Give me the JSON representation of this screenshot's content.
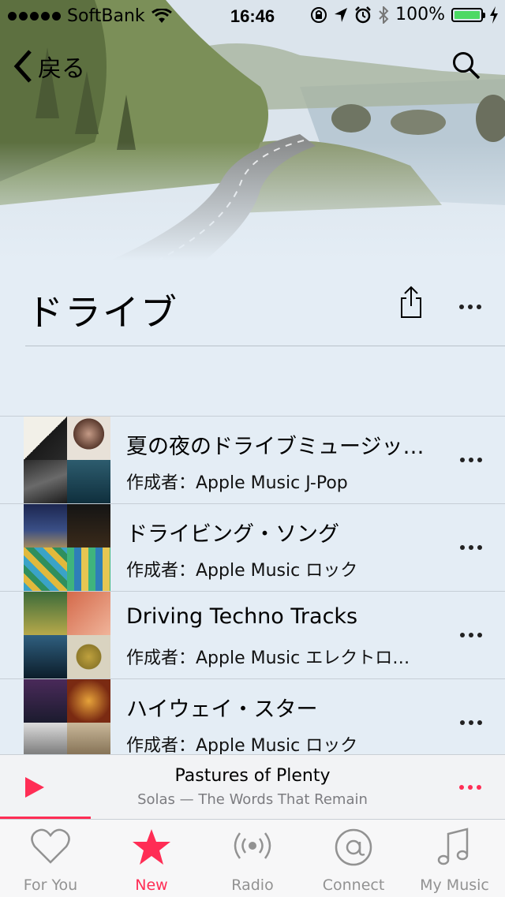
{
  "status_bar": {
    "carrier": "SoftBank",
    "time": "16:46",
    "battery": "100%",
    "battery_level": 1.0,
    "battery_color": "#4cd964"
  },
  "nav": {
    "back_label": "戻る",
    "search_icon": "search-icon"
  },
  "header": {
    "title": "ドライブ",
    "share_icon": "share-icon",
    "more_icon": "more-icon"
  },
  "playlists": [
    {
      "title": "夏の夜のドライブミュージッ…",
      "author": "作成者：Apple Music J-Pop"
    },
    {
      "title": "ドライビング・ソング",
      "author": "作成者：Apple Music ロック"
    },
    {
      "title": "Driving Techno Tracks",
      "author": "作成者：Apple Music エレクトロ…"
    },
    {
      "title": "ハイウェイ・スター",
      "author": "作成者：Apple Music ロック"
    }
  ],
  "now_playing": {
    "song": "Pastures of Plenty",
    "artist_album": "Solas — The Words That Remain",
    "progress": 0.18
  },
  "tabs": [
    {
      "label": "For You",
      "icon": "heart-icon",
      "active": false
    },
    {
      "label": "New",
      "icon": "star-icon",
      "active": true
    },
    {
      "label": "Radio",
      "icon": "radio-icon",
      "active": false
    },
    {
      "label": "Connect",
      "icon": "at-icon",
      "active": false
    },
    {
      "label": "My Music",
      "icon": "music-note-icon",
      "active": false
    }
  ],
  "accent_color": "#ff2d55"
}
